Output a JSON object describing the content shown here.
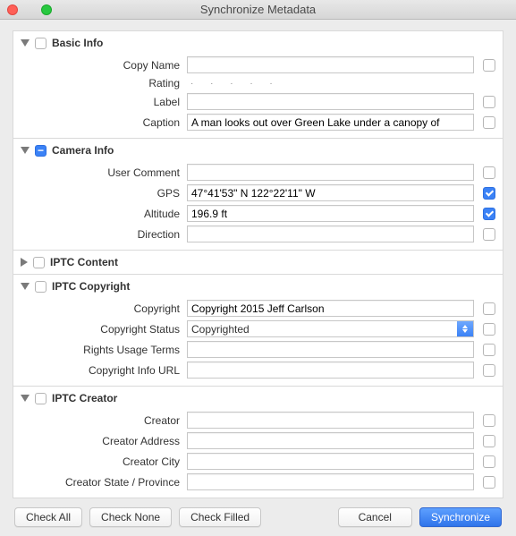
{
  "window": {
    "title": "Synchronize Metadata"
  },
  "sections": {
    "basic": {
      "title": "Basic Info",
      "fields": {
        "copy_name": {
          "label": "Copy Name",
          "value": ""
        },
        "rating": {
          "label": "Rating"
        },
        "label_field": {
          "label": "Label",
          "value": ""
        },
        "caption": {
          "label": "Caption",
          "value": "A man looks out over Green Lake under a canopy of"
        }
      }
    },
    "camera": {
      "title": "Camera Info",
      "fields": {
        "user_comment": {
          "label": "User Comment",
          "value": ""
        },
        "gps": {
          "label": "GPS",
          "value": "47°41'53\" N 122°22'11\" W"
        },
        "altitude": {
          "label": "Altitude",
          "value": "196.9 ft"
        },
        "direction": {
          "label": "Direction",
          "value": ""
        }
      }
    },
    "iptc_content": {
      "title": "IPTC Content"
    },
    "iptc_copyright": {
      "title": "IPTC Copyright",
      "fields": {
        "copyright": {
          "label": "Copyright",
          "value": "Copyright 2015 Jeff Carlson"
        },
        "status": {
          "label": "Copyright Status",
          "value": "Copyrighted"
        },
        "rights": {
          "label": "Rights Usage Terms",
          "value": ""
        },
        "info_url": {
          "label": "Copyright Info URL",
          "value": ""
        }
      }
    },
    "iptc_creator": {
      "title": "IPTC Creator",
      "fields": {
        "creator": {
          "label": "Creator",
          "value": ""
        },
        "address": {
          "label": "Creator Address",
          "value": ""
        },
        "city": {
          "label": "Creator City",
          "value": ""
        },
        "state": {
          "label": "Creator State / Province",
          "value": ""
        }
      }
    }
  },
  "footer": {
    "check_all": "Check All",
    "check_none": "Check None",
    "check_filled": "Check Filled",
    "cancel": "Cancel",
    "synchronize": "Synchronize"
  }
}
